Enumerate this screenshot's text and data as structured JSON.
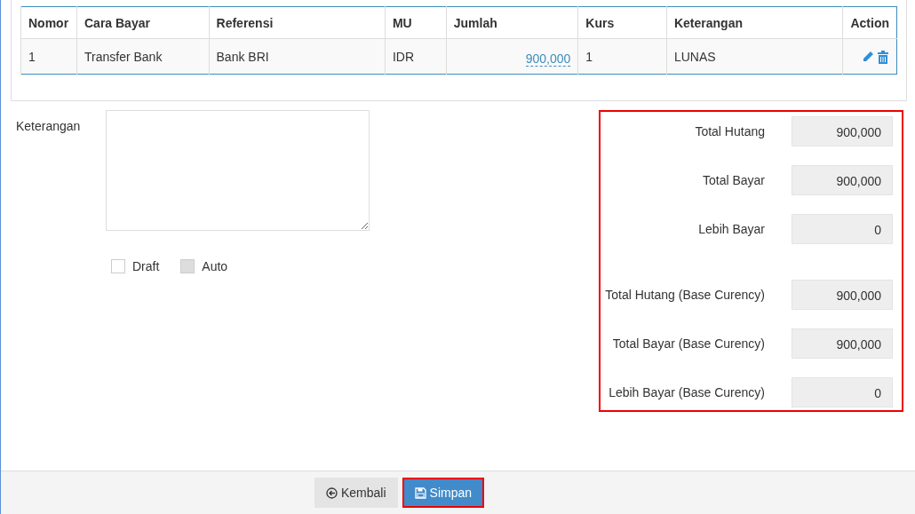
{
  "payments_table": {
    "columns": [
      "Nomor",
      "Cara Bayar",
      "Referensi",
      "MU",
      "Jumlah",
      "Kurs",
      "Keterangan",
      "Action"
    ],
    "rows": [
      {
        "nomor": "1",
        "cara_bayar": "Transfer Bank",
        "referensi": "Bank BRI",
        "mu": "IDR",
        "jumlah": "900,000",
        "kurs": "1",
        "keterangan": "LUNAS"
      }
    ]
  },
  "notes": {
    "label": "Keterangan"
  },
  "checkboxes": [
    {
      "label": "Draft",
      "checked": false,
      "disabled": false
    },
    {
      "label": "Auto",
      "checked": false,
      "disabled": true
    }
  ],
  "summary": {
    "highlighted": true,
    "groups": [
      [
        {
          "label": "Total Hutang",
          "value": "900,000"
        },
        {
          "label": "Total Bayar",
          "value": "900,000"
        },
        {
          "label": "Lebih Bayar",
          "value": "0"
        }
      ],
      [
        {
          "label": "Total Hutang (Base Curency)",
          "value": "900,000"
        },
        {
          "label": "Total Bayar (Base Curency)",
          "value": "900,000"
        },
        {
          "label": "Lebih Bayar (Base Curency)",
          "value": "0"
        }
      ]
    ]
  },
  "buttons": [
    {
      "kind": "back",
      "label": "Kembali",
      "highlighted": false
    },
    {
      "kind": "save",
      "label": "Simpan",
      "highlighted": true
    }
  ]
}
